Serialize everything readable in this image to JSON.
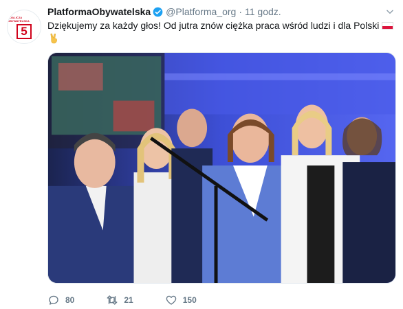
{
  "tweet": {
    "avatar_caption": "KOALICJA OBYWATELSKA",
    "avatar_number": "5",
    "display_name": "PlatformaObywatelska",
    "handle": "@Platforma_org",
    "separator": "·",
    "time": "11 godz.",
    "text": "Dziękujemy za każdy głos! Od jutra znów ciężka praca wśród ludzi i dla Polski"
  },
  "actions": {
    "replies": "80",
    "retweets": "21",
    "likes": "150"
  },
  "icons": {
    "verified": "verified-badge-icon",
    "more": "chevron-down-icon",
    "reply": "reply-icon",
    "retweet": "retweet-icon",
    "like": "heart-icon",
    "flag": "poland-flag-icon",
    "victory": "victory-hand-icon"
  },
  "colors": {
    "text": "#14171a",
    "secondary": "#657786",
    "verified": "#1da1f2",
    "brand_red": "#d0021b"
  }
}
